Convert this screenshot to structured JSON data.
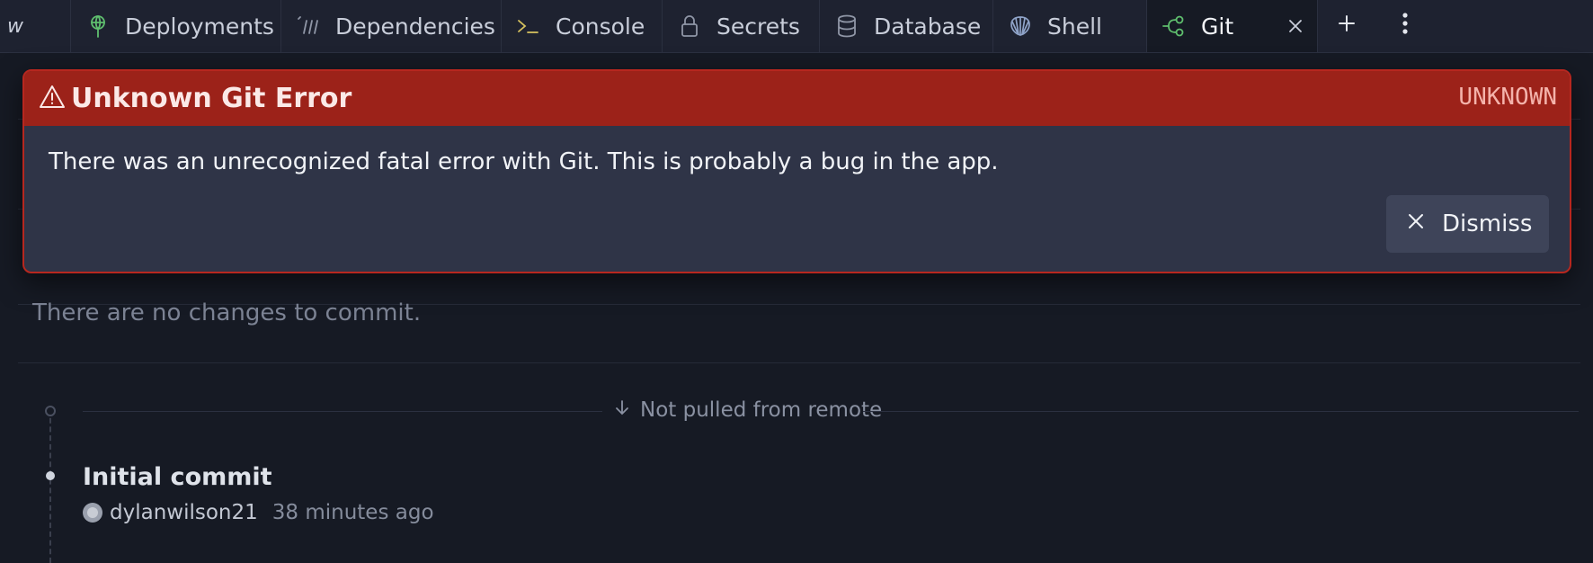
{
  "tabs": [
    {
      "label": "w",
      "icon": "partial-tab-icon"
    },
    {
      "label": "Deployments",
      "icon": "deployments-icon"
    },
    {
      "label": "Dependencies",
      "icon": "dependencies-icon"
    },
    {
      "label": "Console",
      "icon": "terminal-prompt-icon"
    },
    {
      "label": "Secrets",
      "icon": "lock-icon"
    },
    {
      "label": "Database",
      "icon": "database-icon"
    },
    {
      "label": "Shell",
      "icon": "shell-icon"
    },
    {
      "label": "Git",
      "icon": "git-branch-icon",
      "active": true
    }
  ],
  "alert": {
    "title": "Unknown Git Error",
    "code": "UNKNOWN",
    "message": "There was an unrecognized fatal error with Git. This is probably a bug in the app.",
    "dismiss_label": "Dismiss",
    "header_color": "#9c2219",
    "border_color": "#b7271f"
  },
  "git": {
    "empty_message": "There are no changes to commit.",
    "remote_status": "Not pulled from remote",
    "commits": [
      {
        "title": "Initial commit",
        "author": "dylanwilson21",
        "time": "38 minutes ago"
      }
    ]
  },
  "colors": {
    "background": "#161a24",
    "tabbar": "#1e2230",
    "accent_green": "#5fbf6e"
  }
}
